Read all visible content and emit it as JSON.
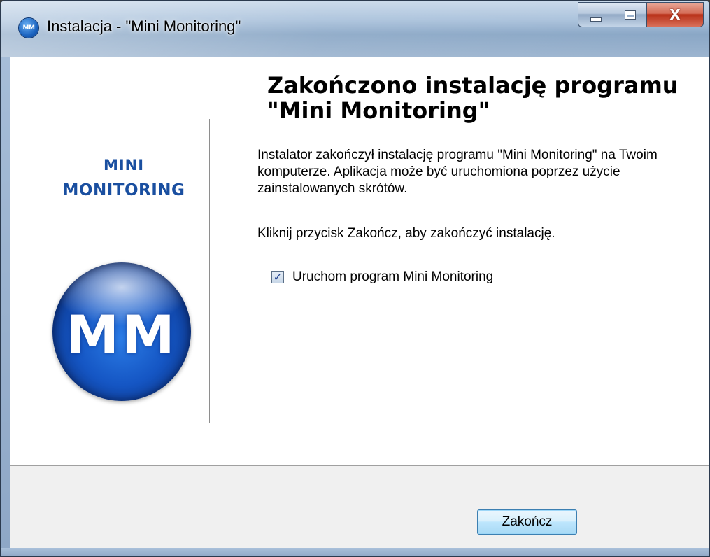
{
  "window": {
    "title": "Instalacja - \"Mini Monitoring\"",
    "icon": "mm-app-icon",
    "icon_text": "MM",
    "caption_buttons": {
      "minimize": "minimize-icon",
      "maximize": "maximize-icon",
      "close_glyph": "X"
    }
  },
  "logo": {
    "line1": "MINI",
    "line2": "MONITORING",
    "circle_text": "MM",
    "color": "#1a4fa0"
  },
  "main": {
    "heading": "Zakończono instalację programu \"Mini Monitoring\"",
    "paragraph1": "Instalator zakończył instalację programu \"Mini Monitoring\" na Twoim komputerze. Aplikacja może być uruchomiona poprzez użycie zainstalowanych skrótów.",
    "paragraph2": "Kliknij przycisk Zakończ, aby zakończyć instalację.",
    "checkbox": {
      "label": "Uruchom program Mini Monitoring",
      "checked": true,
      "check_glyph": "✓"
    }
  },
  "footer": {
    "finish_label": "Zakończ"
  }
}
